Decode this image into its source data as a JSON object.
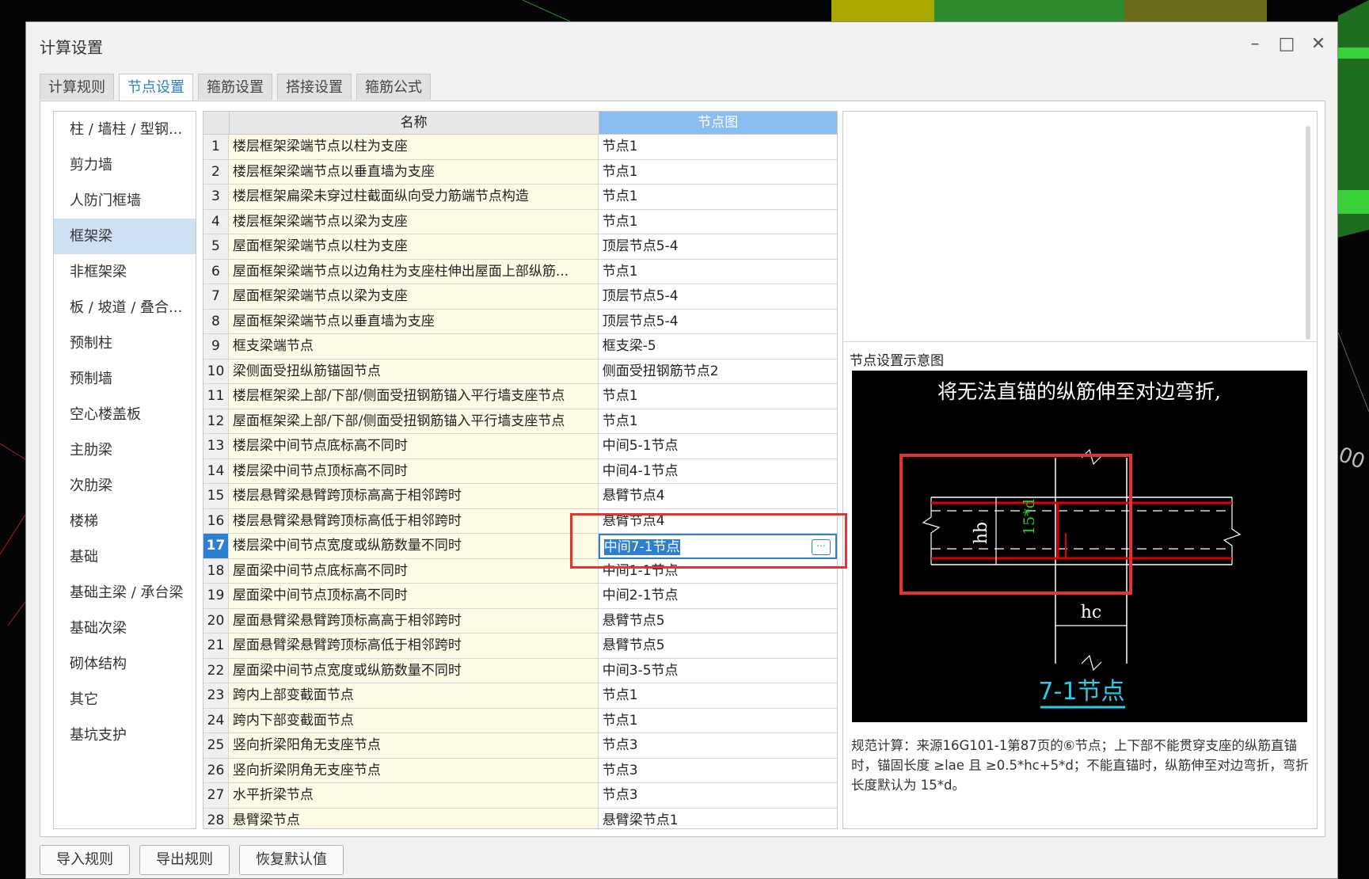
{
  "window": {
    "title": "计算设置"
  },
  "tabs": [
    {
      "label": "计算规则"
    },
    {
      "label": "节点设置"
    },
    {
      "label": "箍筋设置"
    },
    {
      "label": "搭接设置"
    },
    {
      "label": "箍筋公式"
    }
  ],
  "sidebar": {
    "items": [
      {
        "label": "柱 / 墙柱 / 型钢..."
      },
      {
        "label": "剪力墙"
      },
      {
        "label": "人防门框墙"
      },
      {
        "label": "框架梁"
      },
      {
        "label": "非框架梁"
      },
      {
        "label": "板 / 坡道 / 叠合..."
      },
      {
        "label": "预制柱"
      },
      {
        "label": "预制墙"
      },
      {
        "label": "空心楼盖板"
      },
      {
        "label": "主肋梁"
      },
      {
        "label": "次肋梁"
      },
      {
        "label": "楼梯"
      },
      {
        "label": "基础"
      },
      {
        "label": "基础主梁 / 承台梁"
      },
      {
        "label": "基础次梁"
      },
      {
        "label": "砌体结构"
      },
      {
        "label": "其它"
      },
      {
        "label": "基坑支护"
      }
    ]
  },
  "grid": {
    "col_name": "名称",
    "col_node": "节点图",
    "rows": [
      {
        "num": "1",
        "name": "楼层框架梁端节点以柱为支座",
        "node": "节点1"
      },
      {
        "num": "2",
        "name": "楼层框架梁端节点以垂直墙为支座",
        "node": "节点1"
      },
      {
        "num": "3",
        "name": "楼层框架扁梁未穿过柱截面纵向受力筋端节点构造",
        "node": "节点1"
      },
      {
        "num": "4",
        "name": "楼层框架梁端节点以梁为支座",
        "node": "节点1"
      },
      {
        "num": "5",
        "name": "屋面框架梁端节点以柱为支座",
        "node": "顶层节点5-4"
      },
      {
        "num": "6",
        "name": "屋面框架梁端节点以边角柱为支座柱伸出屋面上部纵筋...",
        "node": "节点1"
      },
      {
        "num": "7",
        "name": "屋面框架梁端节点以梁为支座",
        "node": "顶层节点5-4"
      },
      {
        "num": "8",
        "name": "屋面框架梁端节点以垂直墙为支座",
        "node": "顶层节点5-4"
      },
      {
        "num": "9",
        "name": "框支梁端节点",
        "node": "框支梁-5"
      },
      {
        "num": "10",
        "name": "梁侧面受扭纵筋锚固节点",
        "node": "侧面受扭钢筋节点2"
      },
      {
        "num": "11",
        "name": "楼层框架梁上部/下部/侧面受扭钢筋锚入平行墙支座节点",
        "node": "节点1"
      },
      {
        "num": "12",
        "name": "屋面框架梁上部/下部/侧面受扭钢筋锚入平行墙支座节点",
        "node": "节点1"
      },
      {
        "num": "13",
        "name": "楼层梁中间节点底标高不同时",
        "node": "中间5-1节点"
      },
      {
        "num": "14",
        "name": "楼层梁中间节点顶标高不同时",
        "node": "中间4-1节点"
      },
      {
        "num": "15",
        "name": "楼层悬臂梁悬臂跨顶标高高于相邻跨时",
        "node": "悬臂节点4"
      },
      {
        "num": "16",
        "name": "楼层悬臂梁悬臂跨顶标高低于相邻跨时",
        "node": "悬臂节点4"
      },
      {
        "num": "17",
        "name": "楼层梁中间节点宽度或纵筋数量不同时",
        "node": "中间7-1节点"
      },
      {
        "num": "18",
        "name": "屋面梁中间节点底标高不同时",
        "node": "中间1-1节点"
      },
      {
        "num": "19",
        "name": "屋面梁中间节点顶标高不同时",
        "node": "中间2-1节点"
      },
      {
        "num": "20",
        "name": "屋面悬臂梁悬臂跨顶标高高于相邻跨时",
        "node": "悬臂节点5"
      },
      {
        "num": "21",
        "name": "屋面悬臂梁悬臂跨顶标高低于相邻跨时",
        "node": "悬臂节点5"
      },
      {
        "num": "22",
        "name": "屋面梁中间节点宽度或纵筋数量不同时",
        "node": "中间3-5节点"
      },
      {
        "num": "23",
        "name": "跨内上部变截面节点",
        "node": "节点1"
      },
      {
        "num": "24",
        "name": "跨内下部变截面节点",
        "node": "节点1"
      },
      {
        "num": "25",
        "name": "竖向折梁阳角无支座节点",
        "node": "节点3"
      },
      {
        "num": "26",
        "name": "竖向折梁阴角无支座节点",
        "node": "节点3"
      },
      {
        "num": "27",
        "name": "水平折梁节点",
        "node": "节点3"
      },
      {
        "num": "28",
        "name": "悬臂梁节点",
        "node": "悬臂梁节点1"
      }
    ]
  },
  "diagram": {
    "label": "节点设置示意图",
    "caption": "将无法直锚的纵筋伸至对边弯折,",
    "dim_hb": "hb",
    "dim_15d": "15*d",
    "dim_hc": "hc",
    "node_title": "7-1节点"
  },
  "description": "规范计算：来源16G101-1第87页的⑥节点；上下部不能贯穿支座的纵筋直锚时，锚固长度 ≥lae 且 ≥0.5*hc+5*d；不能直锚时，纵筋伸至对边弯折，弯折长度默认为 15*d。",
  "buttons": {
    "import": "导入规则",
    "export": "导出规则",
    "restore": "恢复默认值"
  },
  "background_label": "00",
  "colors": {
    "accent": "#2d7fd0",
    "header_selected": "#89bdf0",
    "annotation_red": "#e53333",
    "name_cell_bg": "#fdfbe6"
  }
}
